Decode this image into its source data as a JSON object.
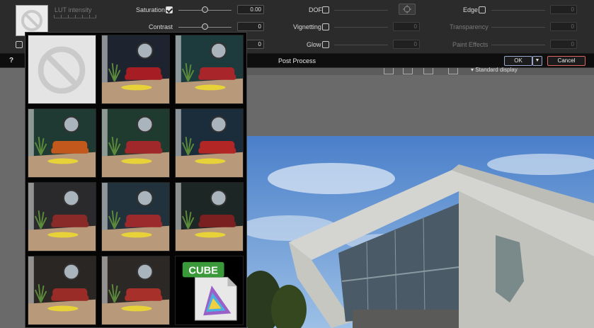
{
  "toolbar": {
    "lut_intensity_label": "LUT intensity",
    "saturation": {
      "label": "Saturation",
      "checked": true,
      "value": "0.00"
    },
    "contrast": {
      "label": "Contrast",
      "value": "0"
    },
    "third_value": "0",
    "dof": {
      "label": "DOF",
      "checked": false
    },
    "vignetting": {
      "label": "Vignetting",
      "checked": false,
      "value": "0"
    },
    "glow": {
      "label": "Glow",
      "checked": false,
      "value": "0"
    },
    "edge": {
      "label": "Edge",
      "checked": false,
      "value": "0"
    },
    "transparency": {
      "label": "Transparency",
      "value": "0"
    },
    "paint_effects": {
      "label": "Paint Effects",
      "value": "0"
    }
  },
  "footer": {
    "help_label": "?",
    "title": "Post Process",
    "ok_label": "OK",
    "cancel_label": "Cancel"
  },
  "background": {
    "display_mode": "Standard display"
  },
  "lut_grid": {
    "cube_label": "CUBE",
    "presets": [
      {
        "icon": "no-lut-icon",
        "tint": "#e6e6e6",
        "sofa": "#cccccc"
      },
      {
        "icon": "lut-preset",
        "tint": "#1d2430",
        "sofa": "#a61e24"
      },
      {
        "icon": "lut-preset",
        "tint": "#1d3a3c",
        "sofa": "#a8262a"
      },
      {
        "icon": "lut-preset",
        "tint": "#1f3a32",
        "sofa": "#c2581c"
      },
      {
        "icon": "lut-preset",
        "tint": "#1f3a2e",
        "sofa": "#a0282a"
      },
      {
        "icon": "lut-preset",
        "tint": "#1b2c3a",
        "sofa": "#b32626"
      },
      {
        "icon": "lut-preset",
        "tint": "#2a2a2c",
        "sofa": "#8a2a28"
      },
      {
        "icon": "lut-preset",
        "tint": "#22323c",
        "sofa": "#9a2a2c"
      },
      {
        "icon": "lut-preset",
        "tint": "#1c2624",
        "sofa": "#7a2020"
      },
      {
        "icon": "lut-preset",
        "tint": "#2a2624",
        "sofa": "#9a2c28"
      },
      {
        "icon": "lut-preset",
        "tint": "#2c2826",
        "sofa": "#a8302a"
      },
      {
        "icon": "cube-file-icon",
        "tint": "#000000",
        "sofa": "#000000"
      }
    ]
  }
}
